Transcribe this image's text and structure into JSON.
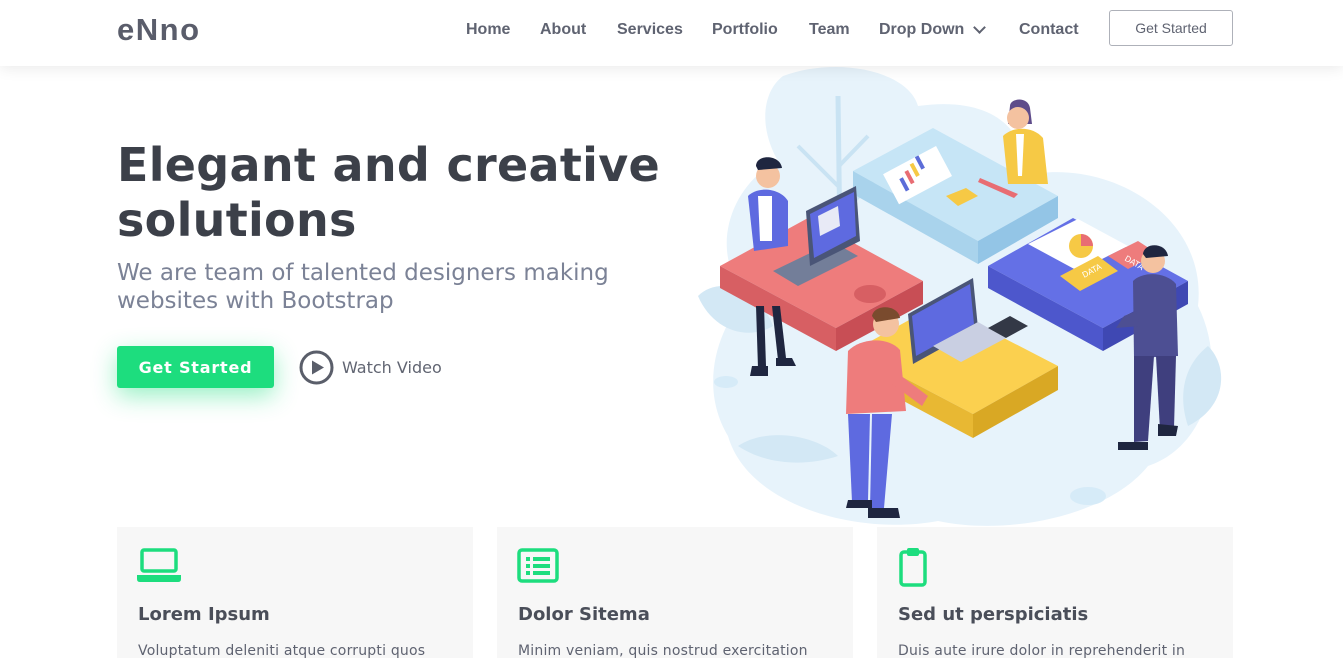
{
  "header": {
    "logo": "eNno",
    "nav": [
      "Home",
      "About",
      "Services",
      "Portfolio",
      "Team",
      "Drop Down",
      "Contact"
    ],
    "cta": "Get Started"
  },
  "hero": {
    "title_line1": "Elegant and creative",
    "title_line2": "solutions",
    "subtitle_line1": "We are team of talented designers making",
    "subtitle_line2": "websites with Bootstrap",
    "primary_button": "Get Started",
    "video_button": "Watch Video",
    "illustration_labels": [
      "DATA",
      "DATA"
    ]
  },
  "features": [
    {
      "icon": "laptop-icon",
      "title": "Lorem Ipsum",
      "text": "Voluptatum deleniti atque corrupti quos"
    },
    {
      "icon": "list-icon",
      "title": "Dolor Sitema",
      "text": "Minim veniam, quis nostrud exercitation"
    },
    {
      "icon": "clipboard-icon",
      "title": "Sed ut perspiciatis",
      "text": "Duis aute irure dolor in reprehenderit in"
    }
  ],
  "colors": {
    "accent": "#1ddd7e",
    "heading": "#3c4049",
    "nav": "#5f6371",
    "subtitle": "#7b8296",
    "card_bg": "#f7f7f7"
  }
}
